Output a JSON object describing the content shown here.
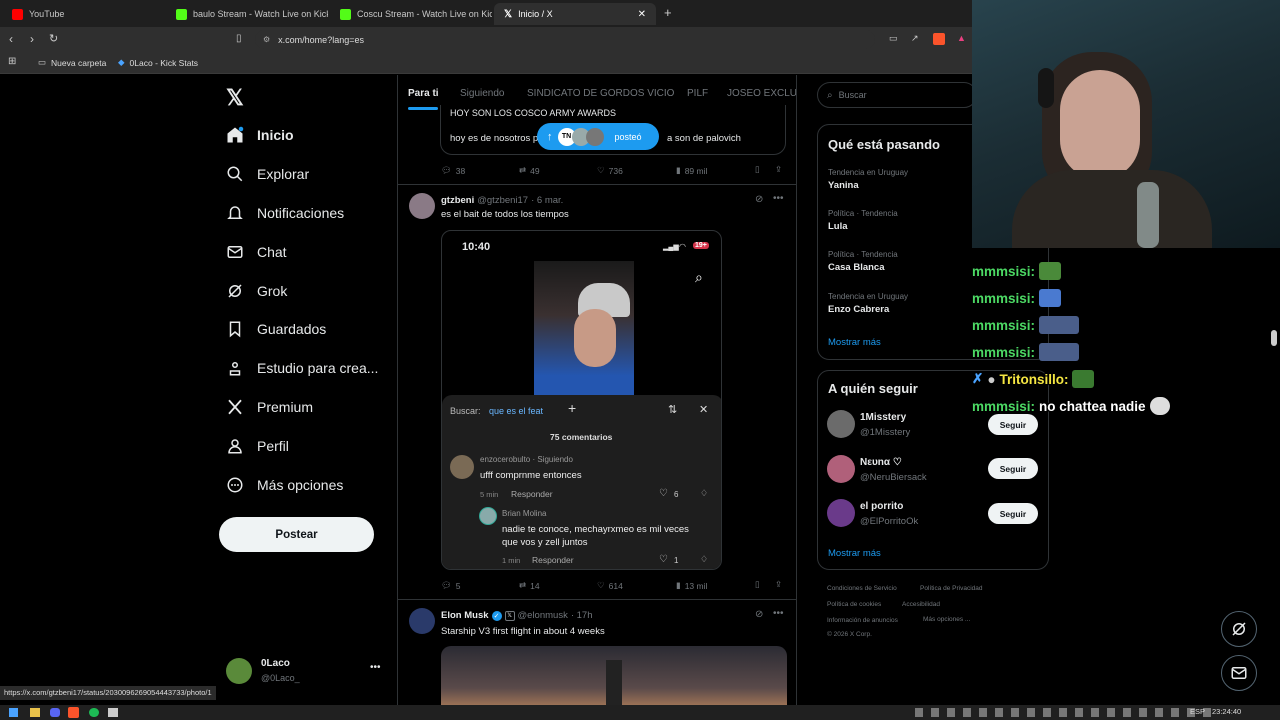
{
  "browser": {
    "tabs": [
      {
        "label": "YouTube",
        "color": "#ff0000"
      },
      {
        "label": "baulo Stream - Watch Live on Kick",
        "color": "#53fc18"
      },
      {
        "label": "Coscu Stream - Watch Live on Kick",
        "color": "#53fc18"
      },
      {
        "label": "Inicio / X",
        "color": "#ffffff",
        "active": true
      }
    ],
    "url": "x.com/home?lang=es",
    "bookmarks": [
      "Nueva carpeta",
      "0Laco - Kick Stats"
    ],
    "status_url": "https://x.com/gtzbeni17/status/2030096269054443733/photo/1"
  },
  "sidebar": {
    "items": [
      {
        "label": "Inicio",
        "icon": "home-icon"
      },
      {
        "label": "Explorar",
        "icon": "search-icon"
      },
      {
        "label": "Notificaciones",
        "icon": "bell-icon"
      },
      {
        "label": "Chat",
        "icon": "mail-icon"
      },
      {
        "label": "Grok",
        "icon": "grok-icon"
      },
      {
        "label": "Guardados",
        "icon": "bookmark-icon"
      },
      {
        "label": "Estudio para crea...",
        "icon": "creator-icon"
      },
      {
        "label": "Premium",
        "icon": "x-icon"
      },
      {
        "label": "Perfil",
        "icon": "person-icon"
      },
      {
        "label": "Más opciones",
        "icon": "more-icon"
      }
    ],
    "post_button": "Postear",
    "account": {
      "name": "0Laco",
      "handle": "@0Laco_"
    }
  },
  "feed": {
    "tabs": [
      "Para ti",
      "Siguiendo",
      "SINDICATO DE GORDOS VICIO",
      "PILF",
      "JOSEO EXCLUSI"
    ],
    "new_posts_pill": "posteó",
    "post0": {
      "text_top": "HOY SON LOS COSCO ARMY AWARDS",
      "text_a": "hoy es de nosotros p",
      "text_b": "a son de palovich",
      "replies": "38",
      "reposts": "49",
      "likes": "736",
      "views": "89 mil"
    },
    "post1": {
      "name": "gtzbeni",
      "handle": "@gtzbeni17",
      "date": "· 6 mar.",
      "text": "es el bait de todos los tiempos",
      "replies": "5",
      "reposts": "14",
      "likes": "614",
      "views": "13 mil",
      "media": {
        "time": "10:40",
        "battery": "19+",
        "search_prefix": "Buscar:",
        "search_query": "que es el feat",
        "comments_count": "75 comentarios",
        "comment1": {
          "user": "enzocerobulto · Siguiendo",
          "text": "ufff comprnme entonces",
          "time": "5 min",
          "reply": "Responder",
          "likes": "6"
        },
        "comment2": {
          "user": "Brian Molina",
          "text1": "nadie te conoce, mechayrxmeo es mil veces",
          "text2": "que vos y zell juntos",
          "time": "1 min",
          "reply": "Responder",
          "likes": "1"
        }
      }
    },
    "post2": {
      "name": "Elon Musk",
      "handle": "@elonmusk",
      "date": "· 17h",
      "text": "Starship V3 first flight in about 4 weeks"
    }
  },
  "right": {
    "search_placeholder": "Buscar",
    "trends_title": "Qué está pasando",
    "trends": [
      {
        "meta": "Tendencia en Uruguay",
        "name": "Yanina"
      },
      {
        "meta": "Política · Tendencia",
        "name": "Lula"
      },
      {
        "meta": "Política · Tendencia",
        "name": "Casa Blanca"
      },
      {
        "meta": "Tendencia en Uruguay",
        "name": "Enzo Cabrera"
      }
    ],
    "show_more": "Mostrar más",
    "follow_title": "A quién seguir",
    "follows": [
      {
        "name": "1Misstery",
        "handle": "@1Misstery",
        "color": "#6b6b6b"
      },
      {
        "name": "Nευnα ♡",
        "handle": "@NeruBiersack",
        "color": "#b0607a"
      },
      {
        "name": "el porrito",
        "handle": "@ElPorritoOk",
        "color": "#6a3a8a"
      }
    ],
    "follow_label": "Seguir",
    "footer": [
      "Condiciones de Servicio",
      "Política de Privacidad",
      "Política de cookies",
      "Accesibilidad",
      "Información de anuncios",
      "Más opciones ...",
      "© 2026 X Corp."
    ]
  },
  "chat": {
    "lines": [
      {
        "user": "mmmsisi:",
        "text": ""
      },
      {
        "user": "mmmsisi:",
        "text": ""
      },
      {
        "user": "mmmsisi:",
        "text": ""
      },
      {
        "user": "mmmsisi:",
        "text": ""
      },
      {
        "user": "Tritonsillo:",
        "text": ""
      },
      {
        "user": "mmmsisi:",
        "text": "no chattea nadie"
      }
    ]
  },
  "taskbar": {
    "lang": "ESP",
    "time": "23:24:40"
  }
}
